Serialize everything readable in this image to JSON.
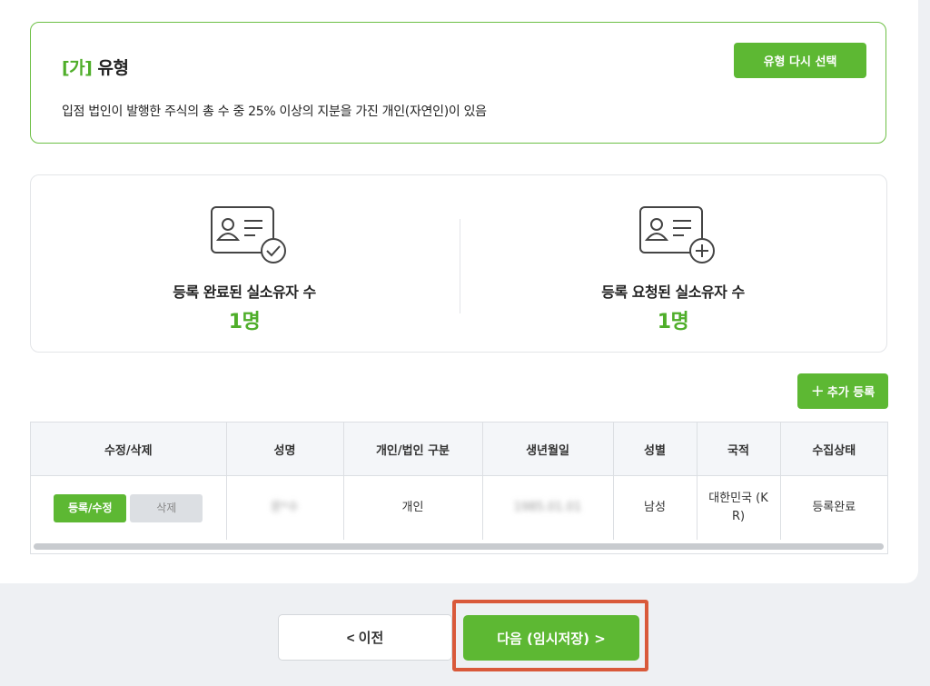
{
  "type_section": {
    "marker": "[가]",
    "title": "유형",
    "description": "입점 법인이 발행한 주식의 총 수 중 25% 이상의 지분을 가진 개인(자연인)이 있음",
    "reselect_button": "유형 다시 선택"
  },
  "stats": {
    "registered": {
      "label": "등록 완료된 실소유자 수",
      "value": "1명",
      "icon": "id-card-check-icon"
    },
    "requested": {
      "label": "등록 요청된 실소유자 수",
      "value": "1명",
      "icon": "id-card-plus-icon"
    }
  },
  "add_button": {
    "plus": "+",
    "label": "추가 등록"
  },
  "table": {
    "headers": [
      "수정/삭제",
      "성명",
      "개인/법인 구분",
      "생년월일",
      "성별",
      "국적",
      "수집상태"
    ],
    "rows": [
      {
        "edit_label": "등록/수정",
        "delete_label": "삭제",
        "name": "문*수",
        "entity_type": "개인",
        "birthdate": "1985.01.01",
        "gender": "남성",
        "nationality": "대한민국 (KR)",
        "status": "등록완료"
      }
    ]
  },
  "nav": {
    "prev_label": "< 이전",
    "next_label": "다음 (임시저장) >"
  },
  "colors": {
    "accent": "#5db833",
    "highlight": "#d9593a"
  }
}
